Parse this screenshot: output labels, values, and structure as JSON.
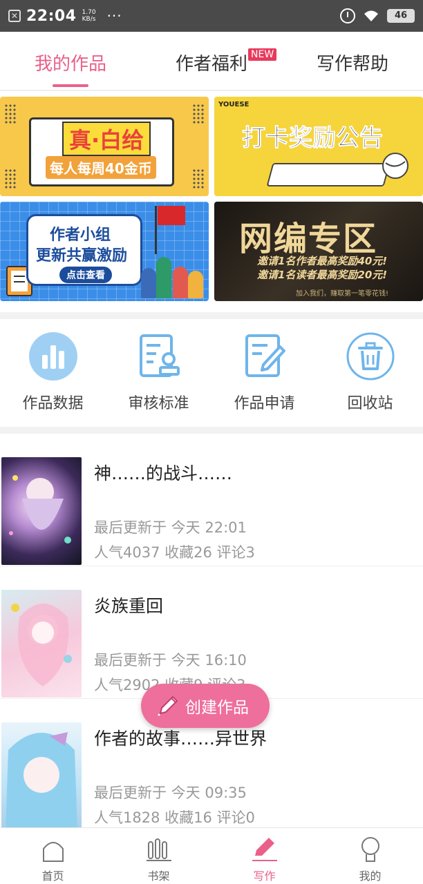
{
  "status_bar": {
    "time": "22:04",
    "speed_value": "1.70",
    "speed_unit": "KB/s",
    "dots": "···",
    "battery": "46"
  },
  "tabs": [
    {
      "label": "我的作品",
      "active": true
    },
    {
      "label": "作者福利",
      "badge": "NEW"
    },
    {
      "label": "写作帮助"
    }
  ],
  "banners": [
    {
      "title": "真·白给",
      "subtitle": "每人每周40金币"
    },
    {
      "title": "打卡奖励公告",
      "brand": "YOUESE"
    },
    {
      "title": "作者小组",
      "line2": "更新共赢激励",
      "button": "点击查看"
    },
    {
      "title": "网编专区",
      "line1": "邀请1名作者最高奖励40元!",
      "line2": "邀请1名读者最高奖励20元!",
      "footer": "加入我们，赚取第一笔零花钱!"
    }
  ],
  "actions": [
    {
      "label": "作品数据",
      "icon": "bar-chart-icon"
    },
    {
      "label": "审核标准",
      "icon": "review-document-icon"
    },
    {
      "label": "作品申请",
      "icon": "edit-document-icon"
    },
    {
      "label": "回收站",
      "icon": "trash-icon"
    }
  ],
  "works": [
    {
      "title": "神……的战斗……",
      "updated": "最后更新于 今天 22:01",
      "stats": "人气4037 收藏26 评论3"
    },
    {
      "title": "炎族重回",
      "updated": "最后更新于 今天 16:10",
      "stats": "人气2902 收藏9 评论3"
    },
    {
      "title": "作者的故事……异世界",
      "updated": "最后更新于 今天 09:35",
      "stats": "人气1828 收藏16 评论0"
    }
  ],
  "fab": {
    "label": "创建作品",
    "icon": "pencil-icon"
  },
  "bottom_nav": [
    {
      "label": "首页",
      "icon": "home-icon"
    },
    {
      "label": "书架",
      "icon": "bookshelf-icon"
    },
    {
      "label": "写作",
      "icon": "pen-icon",
      "active": true
    },
    {
      "label": "我的",
      "icon": "profile-icon"
    }
  ],
  "colors": {
    "accent": "#e9618a",
    "fab": "#ee6f9c",
    "icon_blue": "#5aa9e6",
    "badge": "#e83a5c"
  }
}
